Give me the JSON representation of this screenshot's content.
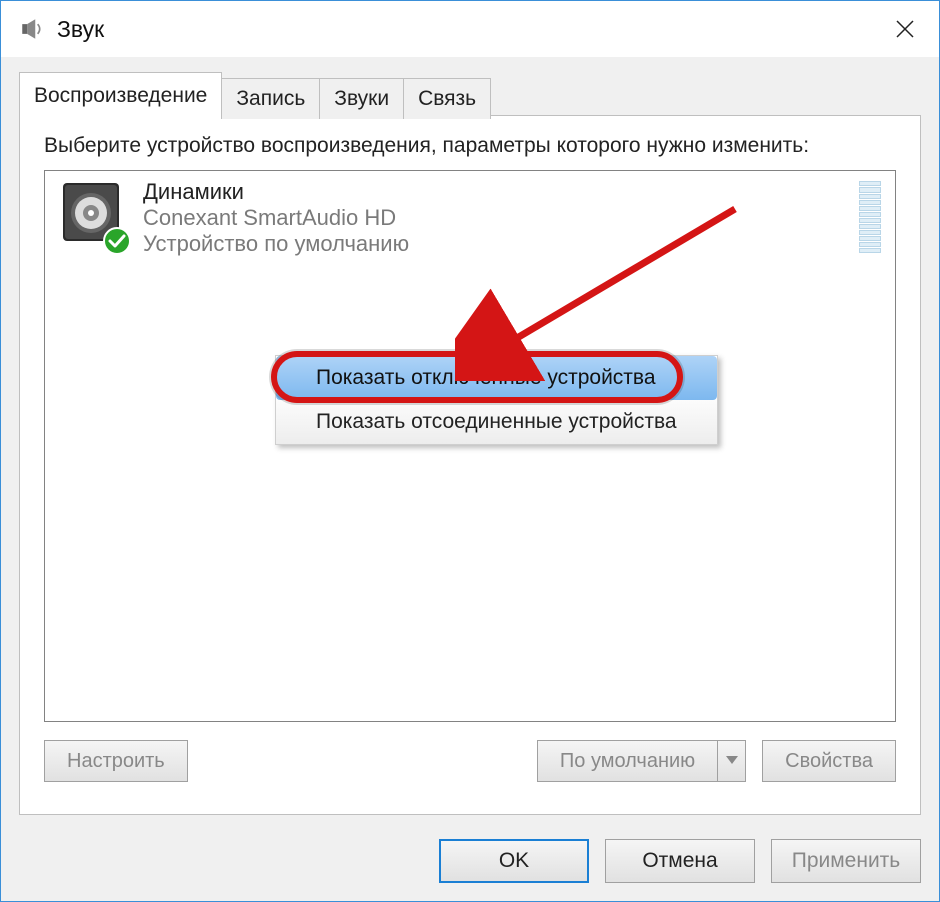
{
  "titlebar": {
    "title": "Звук"
  },
  "tabs": [
    {
      "label": "Воспроизведение"
    },
    {
      "label": "Запись"
    },
    {
      "label": "Звуки"
    },
    {
      "label": "Связь"
    }
  ],
  "instruction": "Выберите устройство воспроизведения, параметры которого нужно изменить:",
  "device": {
    "name": "Динамики",
    "driver": "Conexant SmartAudio HD",
    "status": "Устройство по умолчанию"
  },
  "context_menu": {
    "items": [
      "Показать отключенные устройства",
      "Показать отсоединенные устройства"
    ]
  },
  "bottom_buttons": {
    "configure": "Настроить",
    "default": "По умолчанию",
    "properties": "Свойства"
  },
  "dialog_buttons": {
    "ok": "OK",
    "cancel": "Отмена",
    "apply": "Применить"
  }
}
